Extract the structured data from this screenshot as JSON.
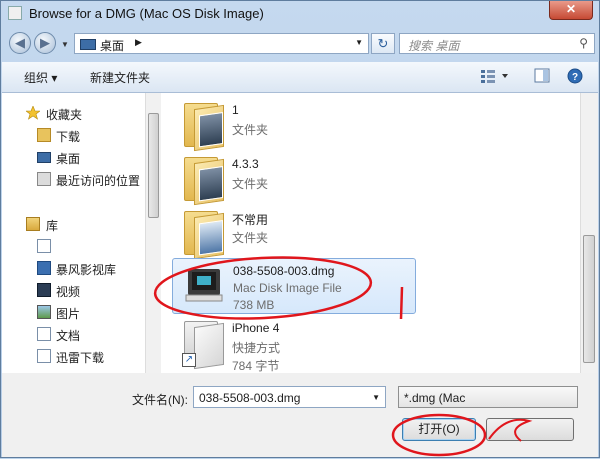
{
  "window": {
    "title": "Browse for a DMG (Mac OS Disk Image)",
    "close_glyph": "✕"
  },
  "nav": {
    "back_glyph": "◀",
    "forward_glyph": "▶",
    "address": "桌面",
    "address_arrow": "▶",
    "search_placeholder": "搜索 桌面"
  },
  "toolbar": {
    "organize": "组织 ▾",
    "new_folder": "新建文件夹"
  },
  "sidebar": {
    "items": [
      {
        "label": "收藏夹"
      },
      {
        "label": "下载"
      },
      {
        "label": "桌面"
      },
      {
        "label": "最近访问的位置"
      },
      {
        "label": "库"
      },
      {
        "label": ""
      },
      {
        "label": "暴风影视库"
      },
      {
        "label": "视频"
      },
      {
        "label": "图片"
      },
      {
        "label": "文档"
      },
      {
        "label": "迅雷下载"
      }
    ]
  },
  "files": [
    {
      "name": "1",
      "type": "文件夹",
      "size": ""
    },
    {
      "name": "4.3.3",
      "type": "文件夹",
      "size": ""
    },
    {
      "name": "不常用",
      "type": "文件夹",
      "size": ""
    },
    {
      "name": "038-5508-003.dmg",
      "type": "Mac Disk Image File",
      "size": "738 MB"
    },
    {
      "name": "iPhone 4",
      "type": "快捷方式",
      "size": "784 字节"
    }
  ],
  "bottom": {
    "filename_label": "文件名(N):",
    "filename_value": "038-5508-003.dmg",
    "filter_value": "*.dmg (Mac",
    "open_label": "打开(O)",
    "cancel_label": ""
  },
  "colors": {
    "annotation_red": "#e0161c",
    "selection": "#d6e8fb"
  }
}
